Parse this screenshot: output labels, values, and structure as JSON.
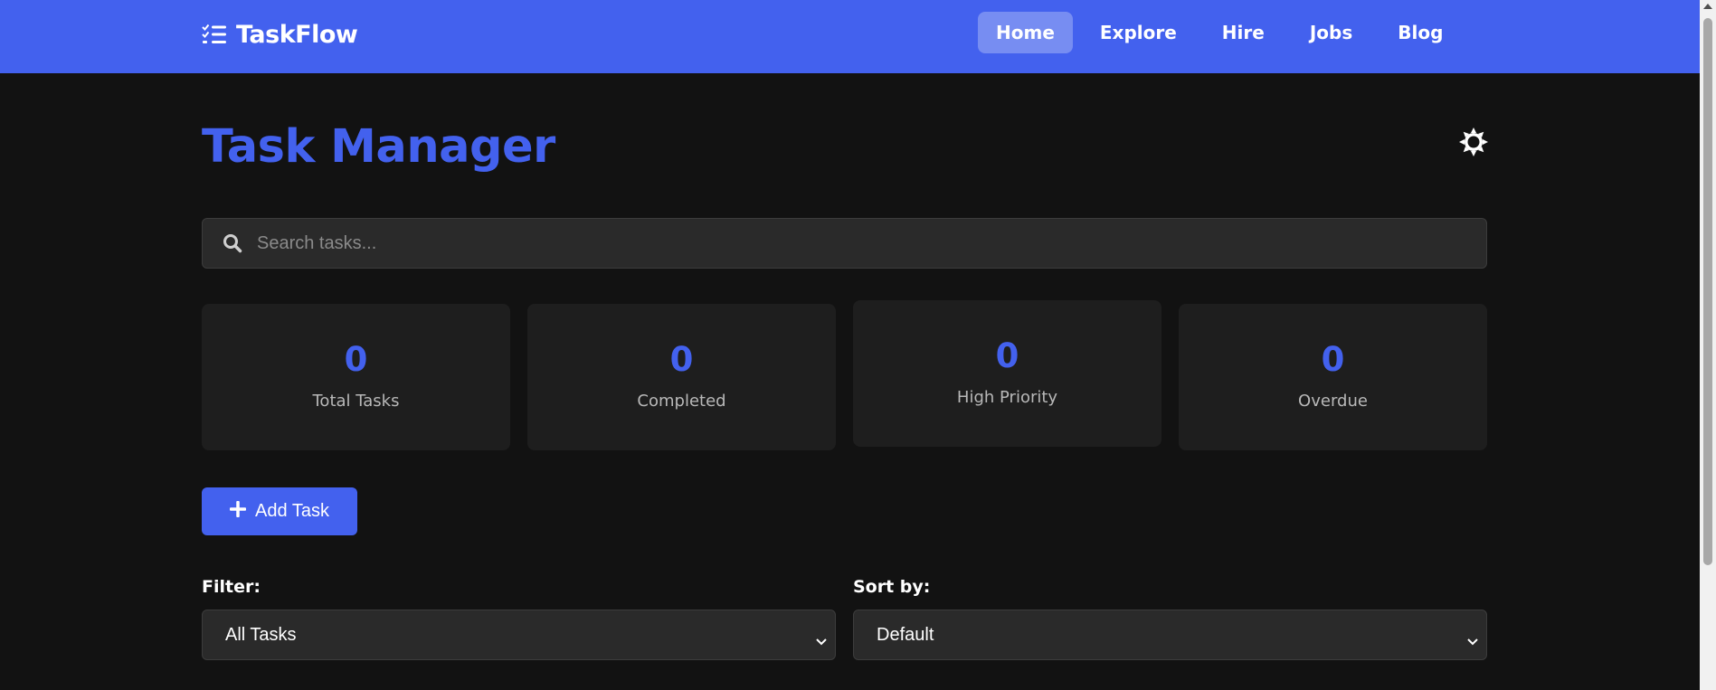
{
  "brand": {
    "name": "TaskFlow",
    "icon": "checklist-icon"
  },
  "nav": {
    "items": [
      {
        "label": "Home",
        "active": true
      },
      {
        "label": "Explore",
        "active": false
      },
      {
        "label": "Hire",
        "active": false
      },
      {
        "label": "Jobs",
        "active": false
      },
      {
        "label": "Blog",
        "active": false
      }
    ]
  },
  "header": {
    "title": "Task Manager",
    "theme_icon": "sun-icon"
  },
  "search": {
    "placeholder": "Search tasks...",
    "value": "",
    "icon": "search-icon"
  },
  "stats": [
    {
      "value": "0",
      "label": "Total Tasks"
    },
    {
      "value": "0",
      "label": "Completed"
    },
    {
      "value": "0",
      "label": "High Priority"
    },
    {
      "value": "0",
      "label": "Overdue"
    }
  ],
  "actions": {
    "add_task_label": "Add Task",
    "add_icon": "plus-icon"
  },
  "filter": {
    "label": "Filter:",
    "selected": "All Tasks"
  },
  "sort": {
    "label": "Sort by:",
    "selected": "Default"
  },
  "colors": {
    "accent": "#4361ee",
    "background": "#121212",
    "card": "#1e1e1e",
    "input": "#2a2a2a"
  }
}
